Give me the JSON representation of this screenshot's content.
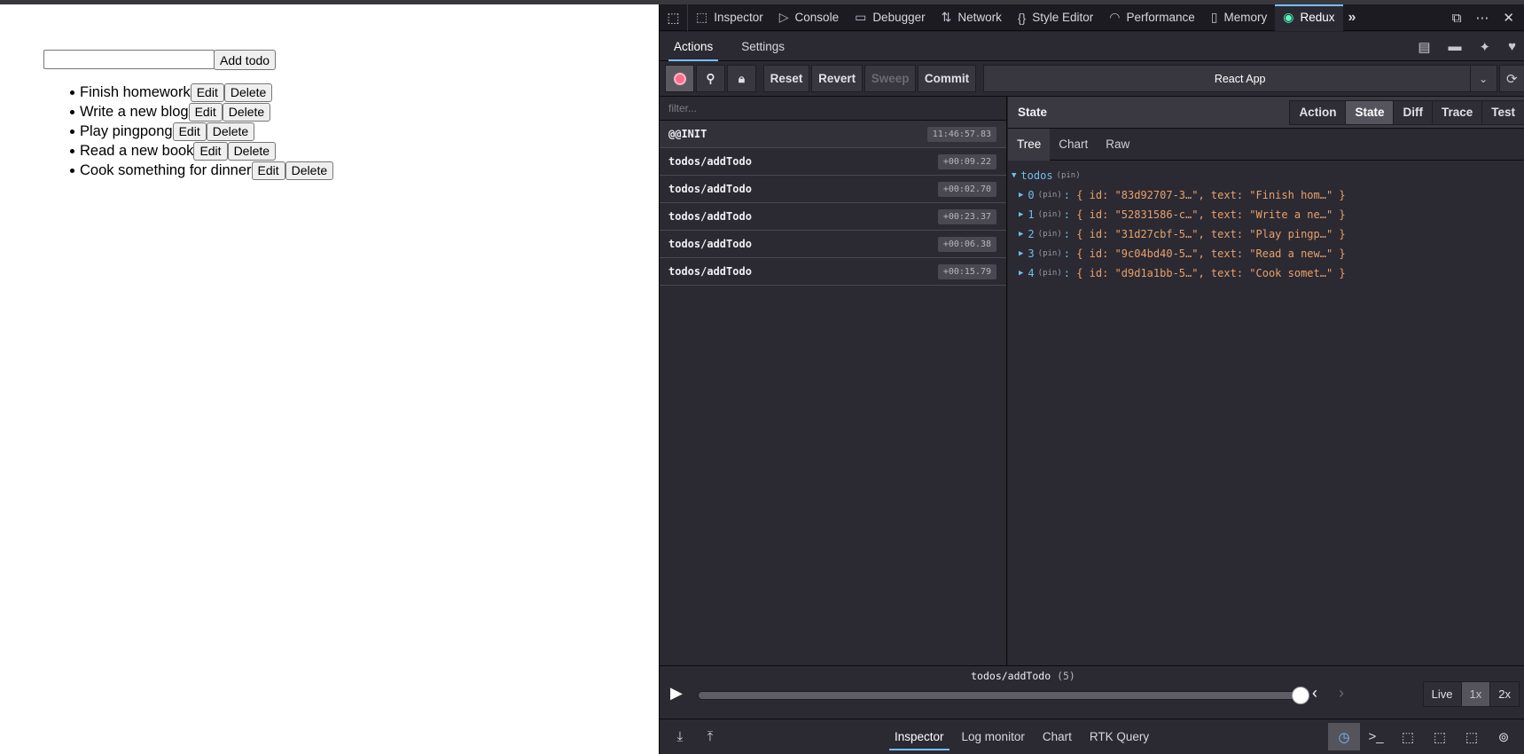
{
  "app": {
    "input_value": "",
    "add_label": "Add todo",
    "todos": [
      {
        "text": "Finish homework",
        "edit": "Edit",
        "delete": "Delete"
      },
      {
        "text": "Write a new blog",
        "edit": "Edit",
        "delete": "Delete"
      },
      {
        "text": "Play pingpong",
        "edit": "Edit",
        "delete": "Delete"
      },
      {
        "text": "Read a new book",
        "edit": "Edit",
        "delete": "Delete"
      },
      {
        "text": "Cook something for dinner",
        "edit": "Edit",
        "delete": "Delete"
      }
    ]
  },
  "devtools": {
    "tabs": [
      {
        "label": "Inspector",
        "icon": "inspector-icon"
      },
      {
        "label": "Console",
        "icon": "console-icon"
      },
      {
        "label": "Debugger",
        "icon": "debugger-icon"
      },
      {
        "label": "Network",
        "icon": "network-icon"
      },
      {
        "label": "Style Editor",
        "icon": "style-editor-icon"
      },
      {
        "label": "Performance",
        "icon": "performance-icon"
      },
      {
        "label": "Memory",
        "icon": "memory-icon"
      },
      {
        "label": "Redux",
        "icon": "redux-icon",
        "active": true
      }
    ],
    "accent": "#75bfff"
  },
  "redux": {
    "head_tabs": [
      "Actions",
      "Settings"
    ],
    "toolbar": {
      "reset": "Reset",
      "revert": "Revert",
      "sweep": "Sweep",
      "commit": "Commit",
      "instance": "React App"
    },
    "filter_placeholder": "filter...",
    "actions": [
      {
        "name": "@@INIT",
        "time": "11:46:57.83"
      },
      {
        "name": "todos/addTodo",
        "time": "+00:09.22"
      },
      {
        "name": "todos/addTodo",
        "time": "+00:02.70"
      },
      {
        "name": "todos/addTodo",
        "time": "+00:23.37"
      },
      {
        "name": "todos/addTodo",
        "time": "+00:06.38"
      },
      {
        "name": "todos/addTodo",
        "time": "+00:15.79"
      }
    ],
    "state": {
      "title": "State",
      "tabs": [
        "Action",
        "State",
        "Diff",
        "Trace",
        "Test"
      ],
      "active_tab": "State",
      "subtabs": [
        "Tree",
        "Chart",
        "Raw"
      ],
      "root_key": "todos",
      "pin": "(pin)",
      "items": [
        {
          "index": "0",
          "summary": "{ id: \"83d92707-3…\", text: \"Finish hom…\" }"
        },
        {
          "index": "1",
          "summary": "{ id: \"52831586-c…\", text: \"Write a ne…\" }"
        },
        {
          "index": "2",
          "summary": "{ id: \"31d27cbf-5…\", text: \"Play pingp…\" }"
        },
        {
          "index": "3",
          "summary": "{ id: \"9c04bd40-5…\", text: \"Read a new…\" }"
        },
        {
          "index": "4",
          "summary": "{ id: \"d9d1a1bb-5…\", text: \"Cook somet…\" }"
        }
      ]
    },
    "slider": {
      "action_label": "todos/addTodo",
      "count": "(5)",
      "position_fraction": 1.0,
      "speeds": [
        "Live",
        "1x",
        "2x"
      ],
      "active_speed": "1x"
    },
    "bottom_tabs": [
      "Inspector",
      "Log monitor",
      "Chart",
      "RTK Query"
    ],
    "active_bottom_tab": "Inspector"
  }
}
